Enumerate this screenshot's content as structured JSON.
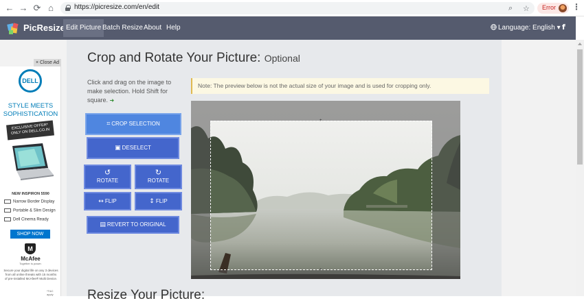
{
  "browser": {
    "url": "https://picresize.com/en/edit",
    "error_label": "Error",
    "nav": {
      "back": "←",
      "forward": "→",
      "reload": "⟳",
      "home": "⌂"
    },
    "zoom_icon": "⌕",
    "star_icon": "☆",
    "menu_icon": "⋮"
  },
  "navbar": {
    "brand": "PicResize",
    "items": [
      "Edit Picture",
      "Batch Resize",
      "About",
      "Help"
    ],
    "active_index": 0,
    "language": "Language: English ▾",
    "social": "f"
  },
  "ad": {
    "close_label": "× Close Ad",
    "dell": "DELL",
    "headline": "STYLE MEETS SOPHISTICATION",
    "headline_1": "STYLE MEETS",
    "headline_2": "SOPHISTICATION",
    "offer_1": "EXCLUSIVE OFFER*",
    "offer_2": "ONLY ON DELL.CO.IN",
    "model": "NEW INSPIRON 5590",
    "features": [
      "Narrow Border Display",
      "Portable & Slim Design",
      "Dell Cinema Ready"
    ],
    "shop": "SHOP NOW",
    "mcafee_mark": "M",
    "mcafee": "McAfee",
    "mcafee_tag": "Together is power.",
    "fine_1": "Secure your digital life on any 3 devices",
    "fine_2": "from all online threats  with 15 months",
    "fine_3": "of pre-installed McAfee® Multi Device.",
    "tc": "*T&C apply"
  },
  "main": {
    "title": "Crop and Rotate Your Picture:",
    "title_optional": "Optional",
    "instructions": "Click and drag on the image to make selection. Hold Shift for square.",
    "instructions_arrow": "➜",
    "note": "Note: The preview below is not the actual size of your image and is used for cropping only.",
    "buttons": {
      "crop": "CROP SELECTION",
      "deselect": "DESELECT",
      "rotate_left": "ROTATE",
      "rotate_right": "ROTATE",
      "flip_h": "FLIP",
      "flip_v": "FLIP",
      "revert": "REVERT TO ORIGINAL"
    },
    "icons": {
      "crop": "⌗",
      "deselect": "▣",
      "rotate_left": "↺",
      "rotate_right": "↻",
      "flip_h": "↔",
      "flip_v": "↕",
      "revert": "▤"
    },
    "next_title": "Resize Your Picture:"
  }
}
